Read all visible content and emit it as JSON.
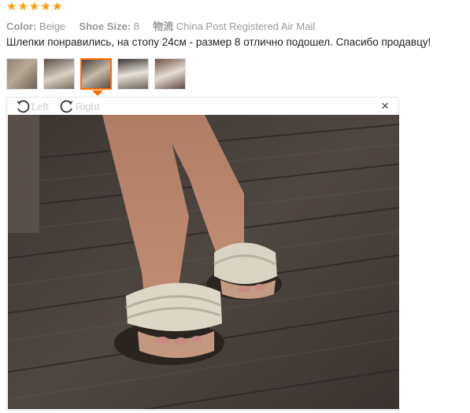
{
  "review": {
    "rating": 5,
    "attributes": [
      {
        "label": "Color:",
        "value": "Beige"
      },
      {
        "label": "Shoe Size:",
        "value": "8"
      },
      {
        "label": "物流",
        "value": "China Post Registered Air Mail"
      }
    ],
    "text": "Шлепки понравились, на стопу 24см - размер 8 отлично подошел. Спасибо продавцу!",
    "thumbnails": 5,
    "active_thumbnail": 3
  },
  "viewer": {
    "rotate_left_label": "Left",
    "rotate_right_label": "Right",
    "close_label": "×"
  },
  "colors": {
    "star": "#ff9a00",
    "accent": "#ff6a00"
  }
}
